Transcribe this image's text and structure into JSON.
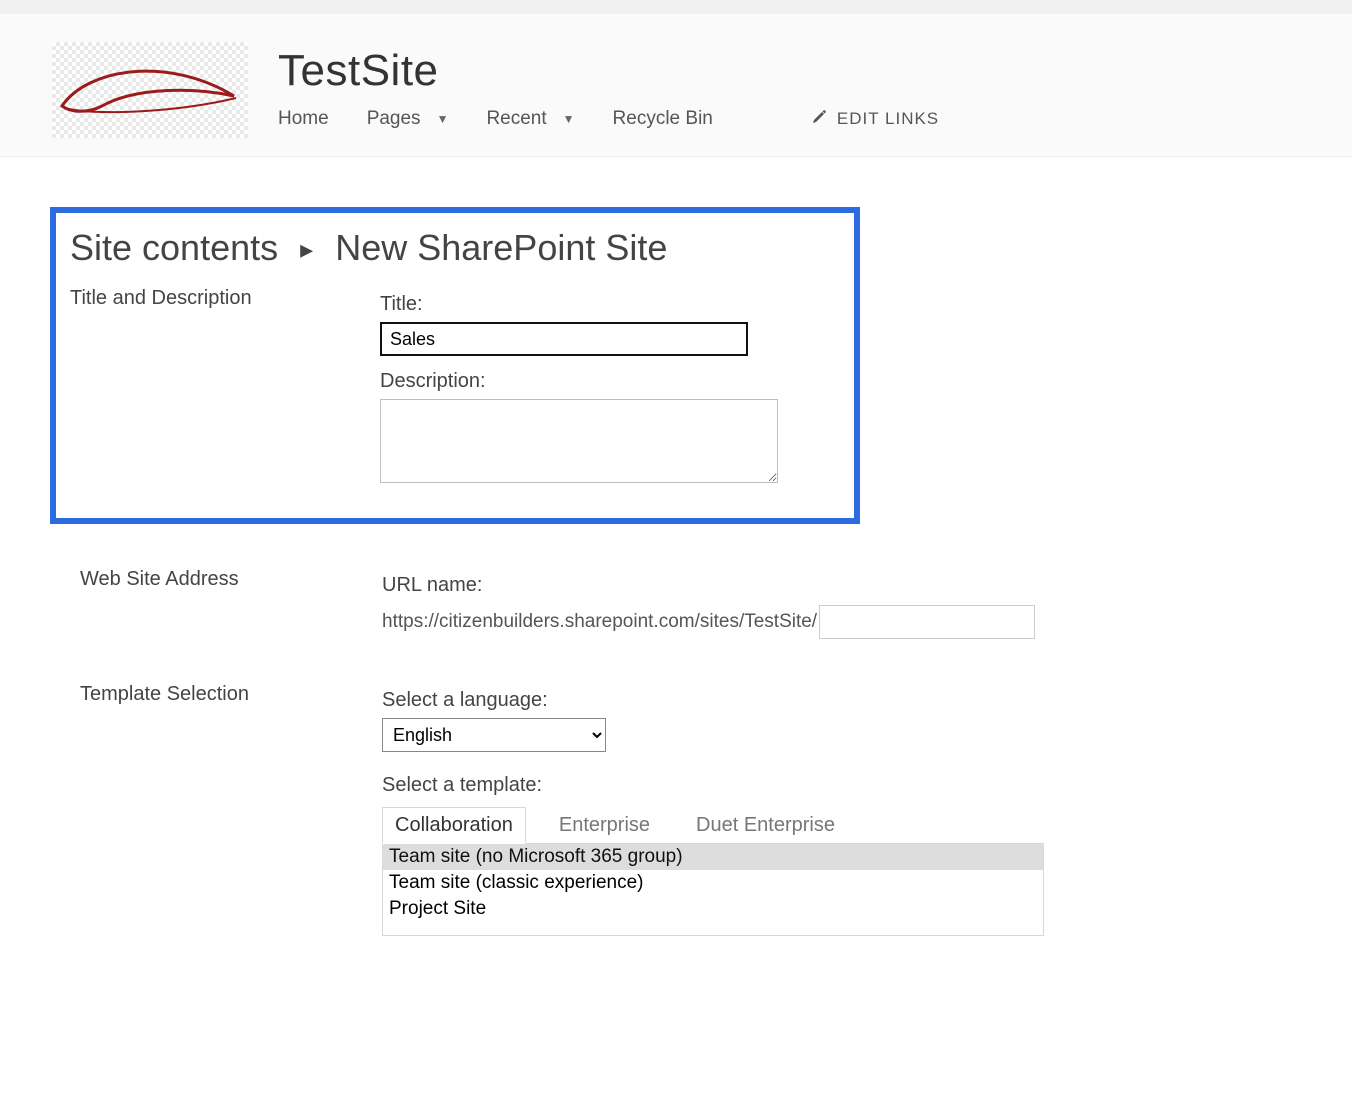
{
  "header": {
    "site_title": "TestSite",
    "nav": [
      "Home",
      "Pages",
      "Recent",
      "Recycle Bin"
    ],
    "edit_links_label": "EDIT LINKS"
  },
  "breadcrumb": {
    "parent": "Site contents",
    "current": "New SharePoint Site"
  },
  "sections": {
    "title_desc": {
      "label": "Title and Description",
      "title_label": "Title:",
      "title_value": "Sales",
      "desc_label": "Description:",
      "desc_value": ""
    },
    "address": {
      "label": "Web Site Address",
      "url_label": "URL name:",
      "url_prefix": "https://citizenbuilders.sharepoint.com/sites/TestSite/",
      "url_value": ""
    },
    "template": {
      "label": "Template Selection",
      "lang_label": "Select a language:",
      "lang_value": "English",
      "tmpl_label": "Select a template:",
      "tabs": [
        "Collaboration",
        "Enterprise",
        "Duet Enterprise"
      ],
      "options": [
        "Team site (no Microsoft 365 group)",
        "Team site (classic experience)",
        "Project Site"
      ]
    }
  }
}
